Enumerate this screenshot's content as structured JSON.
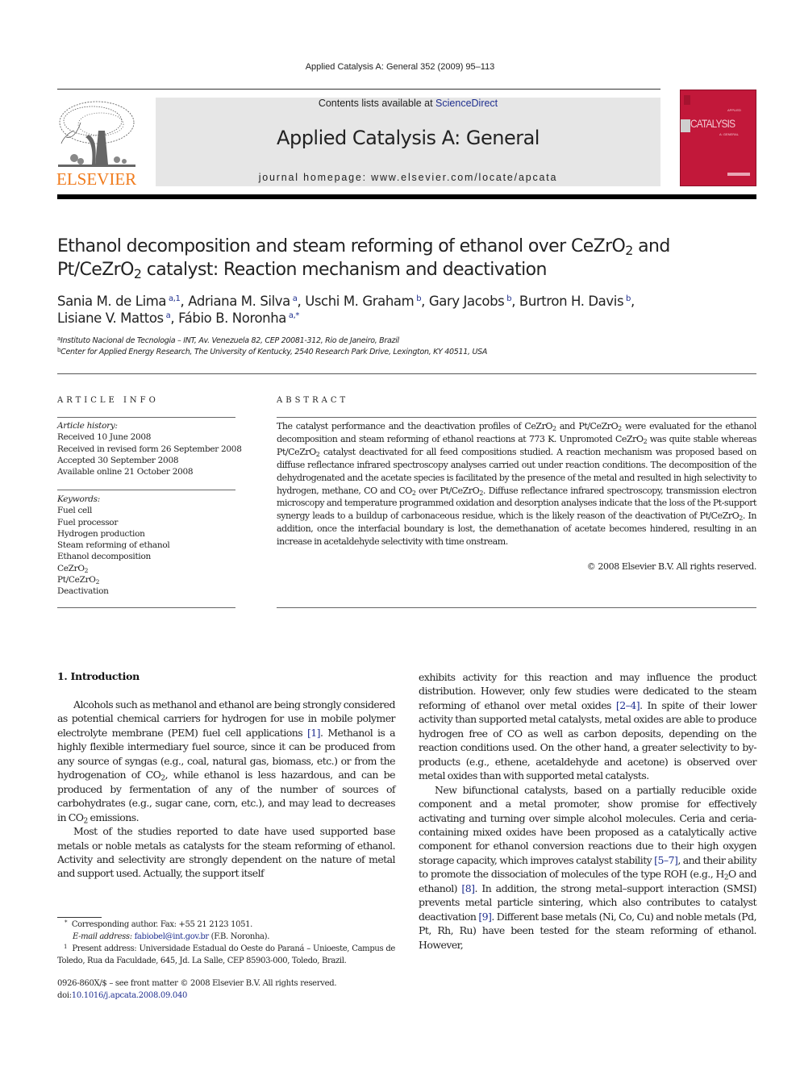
{
  "running_head": "Applied Catalysis A: General 352 (2009) 95–113",
  "masthead": {
    "publisher_logo_text": "ELSEVIER",
    "contents_prefix": "Contents lists available at ",
    "contents_link": "ScienceDirect",
    "journal_name": "Applied Catalysis A: General",
    "homepage": "journal homepage: www.elsevier.com/locate/apcata",
    "cover_title": "CATALYSIS",
    "brand_colors": {
      "elsevier_orange": "#f07b1c",
      "cover_red": "#c2183a",
      "link_blue": "#1f2f8f",
      "masthead_gray": "#e6e6e6"
    }
  },
  "article": {
    "title_line1_pre": "Ethanol decomposition and steam reforming of ethanol over CeZrO",
    "title_line1_sub": "2",
    "title_line1_post": " and",
    "title_line2_pre": "Pt/CeZrO",
    "title_line2_sub": "2",
    "title_line2_post": " catalyst: Reaction mechanism and deactivation",
    "authors": [
      {
        "name": "Sania M. de Lima",
        "marks": "a,1",
        "sep": ", "
      },
      {
        "name": "Adriana M. Silva",
        "marks": "a",
        "sep": ", "
      },
      {
        "name": "Uschi M. Graham",
        "marks": "b",
        "sep": ", "
      },
      {
        "name": "Gary Jacobs",
        "marks": "b",
        "sep": ", "
      },
      {
        "name": "Burtron H. Davis",
        "marks": "b",
        "sep": ","
      },
      {
        "name": "Lisiane V. Mattos",
        "marks": "a",
        "sep": ", "
      },
      {
        "name": "Fábio B. Noronha",
        "marks": "a,*",
        "sep": ""
      }
    ],
    "affiliations": [
      {
        "mark": "a",
        "text": "Instituto Nacional de Tecnologia – INT, Av. Venezuela 82, CEP 20081-312, Rio de Janeiro, Brazil"
      },
      {
        "mark": "b",
        "text": "Center for Applied Energy Research, The University of Kentucky, 2540 Research Park Drive, Lexington, KY 40511, USA"
      }
    ]
  },
  "article_info": {
    "label": "ARTICLE INFO",
    "history_label": "Article history:",
    "history": [
      "Received 10 June 2008",
      "Received in revised form 26 September 2008",
      "Accepted 30 September 2008",
      "Available online 21 October 2008"
    ],
    "keywords_label": "Keywords:",
    "keywords": [
      "Fuel cell",
      "Fuel processor",
      "Hydrogen production",
      "Steam reforming of ethanol",
      "Ethanol decomposition",
      "CeZrO2",
      "Pt/CeZrO2",
      "Deactivation"
    ]
  },
  "abstract": {
    "label": "ABSTRACT",
    "s1": "The catalyst performance and the deactivation profiles of CeZrO",
    "s2": " and Pt/CeZrO",
    "s3": " were evaluated for the ethanol decomposition and steam reforming of ethanol reactions at 773 K. Unpromoted CeZrO",
    "s4": " was quite stable whereas Pt/CeZrO",
    "s5": " catalyst deactivated for all feed compositions studied. A reaction mechanism was proposed based on diffuse reflectance infrared spectroscopy analyses carried out under reaction conditions. The decomposition of the dehydrogenated and the acetate species is facilitated by the presence of the metal and resulted in high selectivity to hydrogen, methane, CO and CO",
    "s6": " over Pt/CeZrO",
    "s7": ". Diffuse reflectance infrared spectroscopy, transmission electron microscopy and temperature programmed oxidation and desorption analyses indicate that the loss of the Pt-support synergy leads to a buildup of carbonaceous residue, which is the likely reason of the deactivation of Pt/CeZrO",
    "s8": ". In addition, once the interfacial boundary is lost, the demethanation of acetate becomes hindered, resulting in an increase in acetaldehyde selectivity with time onstream.",
    "sub2": "2",
    "copyright": "© 2008 Elsevier B.V. All rights reserved."
  },
  "introduction": {
    "heading": "1.  Introduction",
    "p1_a": "Alcohols such as methanol and ethanol are being strongly considered as potential chemical carriers for hydrogen for use in mobile polymer electrolyte membrane (PEM) fuel cell applications ",
    "p1_ref1": "[1]",
    "p1_b": ". Methanol is a highly flexible intermediary fuel source, since it can be produced from any source of syngas (e.g., coal, natural gas, biomass, etc.) or from the hydrogenation of CO",
    "p1_c": ", while ethanol is less hazardous, and can be produced by fermentation of any of the number of sources of carbohydrates (e.g., sugar cane, corn, etc.), and may lead to decreases in CO",
    "p1_d": " emissions.",
    "p2_left": "Most of the studies reported to date have used supported base metals or noble metals as catalysts for the steam reforming of ethanol. Activity and selectivity are strongly dependent on the nature of metal and support used. Actually, the support itself",
    "p2_right_a": "exhibits activity for this reaction and may influence the product distribution. However, only few studies were dedicated to the steam reforming of ethanol over metal oxides ",
    "p2_ref": "[2–4]",
    "p2_right_b": ". In spite of their lower activity than supported metal catalysts, metal oxides are able to produce hydrogen free of CO as well as carbon deposits, depending on the reaction conditions used. On the other hand, a greater selectivity to by-products (e.g., ethene, acetaldehyde and acetone) is observed over metal oxides than with supported metal catalysts.",
    "p3_a": "New bifunctional catalysts, based on a partially reducible oxide component and a metal promoter, show promise for effectively activating and turning over simple alcohol molecules. Ceria and ceria-containing mixed oxides have been proposed as a catalytically active component for ethanol conversion reactions due to their high oxygen storage capacity, which improves catalyst stability ",
    "p3_ref1": "[5–7]",
    "p3_b": ", and their ability to promote the dissociation of molecules of the type ROH (e.g., H",
    "p3_c": "O and ethanol) ",
    "p3_ref2": "[8]",
    "p3_d": ". In addition, the strong metal–support interaction (SMSI) prevents metal particle sintering, which also contributes to catalyst deactivation ",
    "p3_ref3": "[9]",
    "p3_e": ". Different base metals (Ni, Co, Cu) and noble metals (Pd, Pt, Rh, Ru) have been tested for the steam reforming of ethanol. However,"
  },
  "footnotes": {
    "corresponding_mark": "*",
    "corresponding": "Corresponding author. Fax: +55 21 2123 1051.",
    "email_label": "E-mail address:",
    "email": "fabiobel@int.gov.br",
    "email_suffix": " (F.B. Noronha).",
    "present_mark": "1",
    "present_address": "Present address: Universidade Estadual do Oeste do Paraná – Unioeste, Campus de Toledo, Rua da Faculdade, 645, Jd. La Salle, CEP 85903-000, Toledo, Brazil."
  },
  "bottom_info": {
    "issn_line": "0926-860X/$ – see front matter © 2008 Elsevier B.V. All rights reserved.",
    "doi_prefix": "doi:",
    "doi": "10.1016/j.apcata.2008.09.040"
  }
}
